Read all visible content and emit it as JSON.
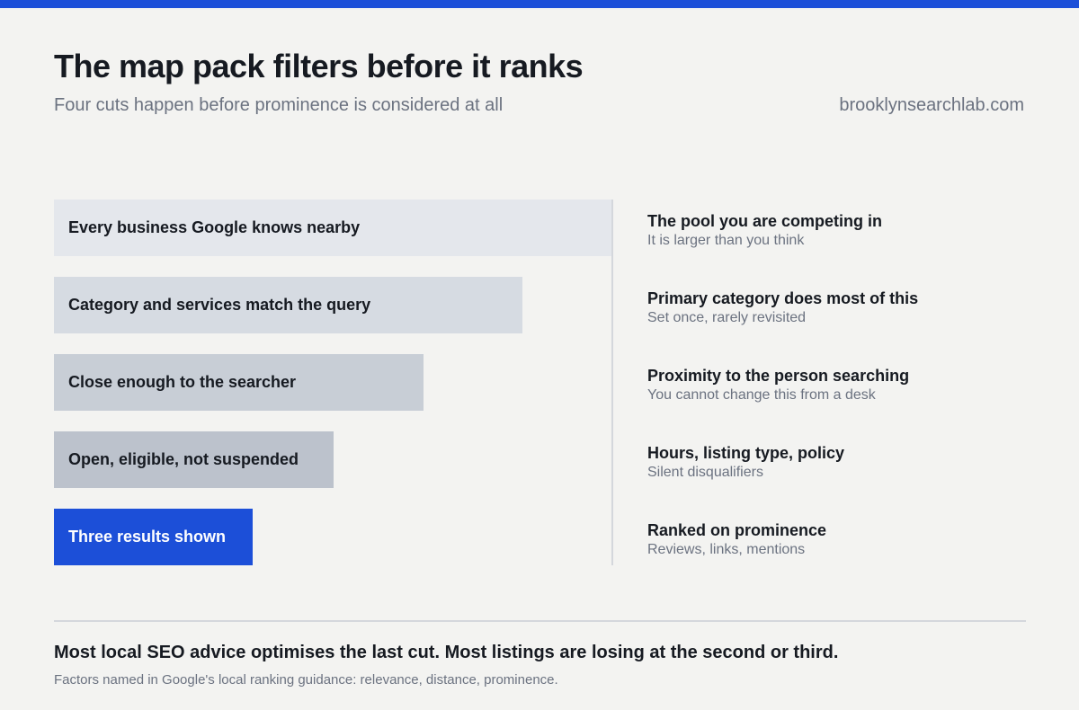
{
  "header": {
    "title": "The map pack filters before it ranks",
    "subtitle": "Four cuts happen before prominence is considered at all",
    "site": "brooklynsearchlab.com"
  },
  "funnel": {
    "stages": [
      {
        "label": "Every business Google knows nearby"
      },
      {
        "label": "Category and services match the query"
      },
      {
        "label": "Close enough to the searcher"
      },
      {
        "label": "Open, eligible, not suspended"
      },
      {
        "label": "Three results shown"
      }
    ]
  },
  "notes": [
    {
      "title": "The pool you are competing in",
      "detail": "It is larger than you think"
    },
    {
      "title": "Primary category does most of this",
      "detail": "Set once, rarely revisited"
    },
    {
      "title": "Proximity to the person searching",
      "detail": "You cannot change this from a desk"
    },
    {
      "title": "Hours, listing type, policy",
      "detail": "Silent disqualifiers"
    },
    {
      "title": "Ranked on prominence",
      "detail": "Reviews, links, mentions"
    }
  ],
  "footer": {
    "takeaway": "Most local SEO advice optimises the last cut. Most listings are losing at the second or third.",
    "source": "Factors named in Google's local ranking guidance: relevance, distance, prominence."
  },
  "colors": {
    "accent": "#1c4fd8",
    "background": "#f3f3f1",
    "stage_fills": [
      "#e4e7ec",
      "#d6dbe2",
      "#c8ced6",
      "#bcc2cc",
      "#1c4fd8"
    ]
  }
}
